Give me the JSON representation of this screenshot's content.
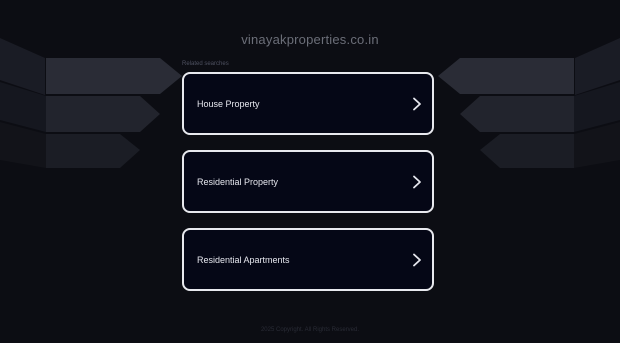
{
  "domain": "vinayakproperties.co.in",
  "related_label": "Related searches",
  "links": [
    {
      "label": "House Property"
    },
    {
      "label": "Residential Property"
    },
    {
      "label": "Residential Apartments"
    }
  ],
  "footer": "2025 Copyright. All Rights Reserved.",
  "colors": {
    "background": "#0c0d13",
    "card_bg": "#050716",
    "card_border": "#e8e9ee",
    "text": "#e6e7ee"
  },
  "icons": {
    "link_arrow": "chevron-right-icon"
  }
}
